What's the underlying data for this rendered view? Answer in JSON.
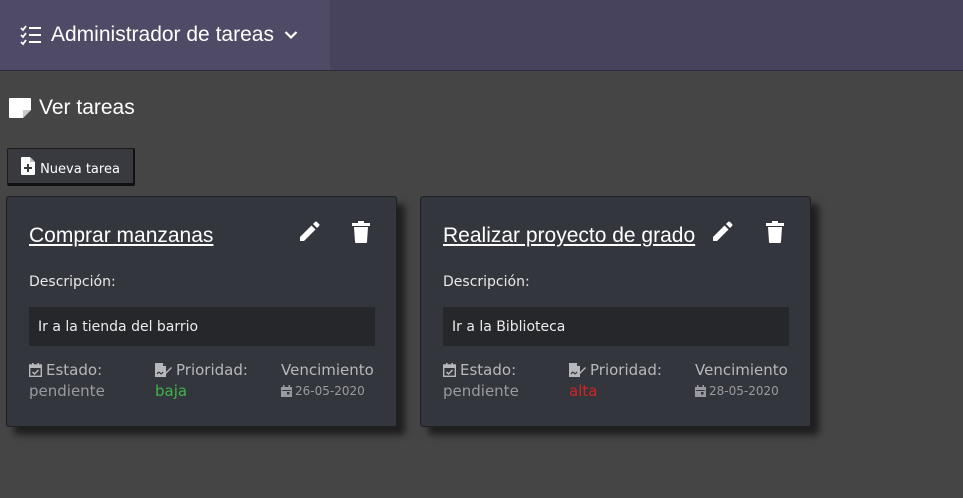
{
  "header": {
    "app_title": "Administrador de tareas",
    "menu_icon": "task-list-icon",
    "dropdown_icon": "chevron-down-icon"
  },
  "page": {
    "title": "Ver tareas",
    "title_icon": "note-icon",
    "new_task_label": "Nueva tarea",
    "new_task_icon": "file-plus-icon"
  },
  "colors": {
    "header_bg": "#48435d",
    "page_bg": "#454545",
    "card_bg": "#33363d",
    "priority_low": "#3fb34a",
    "priority_high": "#d32424",
    "muted_text": "#9a9ba0"
  },
  "tasks": [
    {
      "title": "Comprar manzanas",
      "description_label": "Descripción:",
      "description": "Ir a la tienda del barrio",
      "status_label": "Estado:",
      "status": "pendiente",
      "priority_label": "Prioridad:",
      "priority": "baja",
      "priority_color": "#3fb34a",
      "due_label": "Vencimiento",
      "due_date": "26-05-2020"
    },
    {
      "title": "Realizar proyecto de grado",
      "description_label": "Descripción:",
      "description": "Ir a la Biblioteca",
      "status_label": "Estado:",
      "status": "pendiente",
      "priority_label": "Prioridad:",
      "priority": "alta",
      "priority_color": "#d32424",
      "due_label": "Vencimiento",
      "due_date": "28-05-2020"
    }
  ]
}
